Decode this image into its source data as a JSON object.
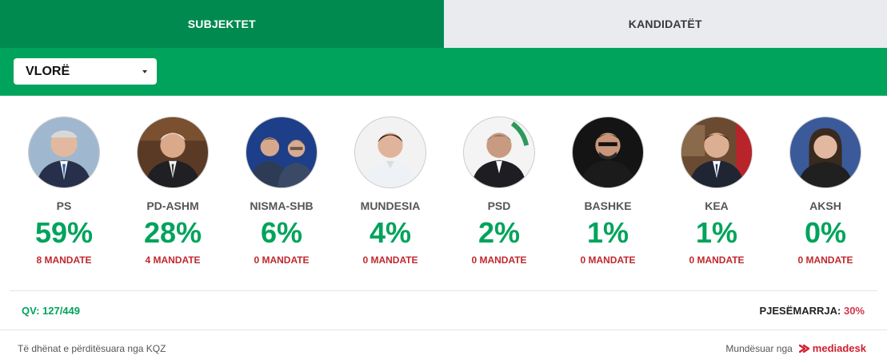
{
  "tabs": [
    {
      "label": "SUBJEKTET",
      "active": true
    },
    {
      "label": "KANDIDATËT",
      "active": false
    }
  ],
  "filter": {
    "selected": "VLORË"
  },
  "parties": [
    {
      "name": "PS",
      "percent": "59%",
      "mandates": "8 MANDATE"
    },
    {
      "name": "PD-ASHM",
      "percent": "28%",
      "mandates": "4 MANDATE"
    },
    {
      "name": "NISMA-SHB",
      "percent": "6%",
      "mandates": "0 MANDATE"
    },
    {
      "name": "MUNDESIA",
      "percent": "4%",
      "mandates": "0 MANDATE"
    },
    {
      "name": "PSD",
      "percent": "2%",
      "mandates": "0 MANDATE"
    },
    {
      "name": "BASHKE",
      "percent": "1%",
      "mandates": "0 MANDATE"
    },
    {
      "name": "KEA",
      "percent": "1%",
      "mandates": "0 MANDATE"
    },
    {
      "name": "AKSH",
      "percent": "0%",
      "mandates": "0 MANDATE"
    }
  ],
  "stats": {
    "qv": "QV: 127/449",
    "turnout_label": "PJESËMARRJA:",
    "turnout_value": "30%"
  },
  "footer": {
    "source": "Të dhënat e përditësuara nga KQZ",
    "powered_by": "Mundësuar nga",
    "brand": "mediadesk"
  },
  "colors": {
    "tab_active": "#008a50",
    "bar_green": "#00a35c",
    "percent_green": "#00a35c",
    "mandate_red": "#c0282f",
    "brand_red": "#d01f2f"
  }
}
